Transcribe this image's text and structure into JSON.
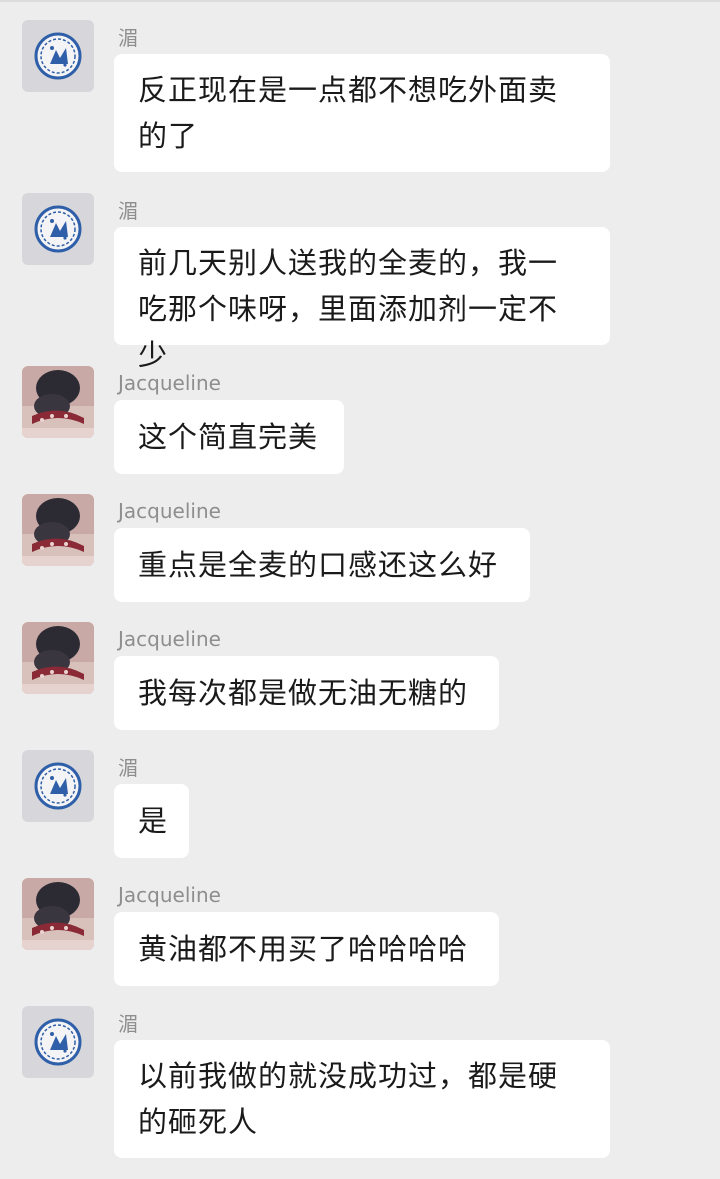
{
  "messages": [
    {
      "sender": "湄",
      "avatar": "blue-circle-logo-avatar",
      "text": "反正现在是一点都不想吃外面卖的了"
    },
    {
      "sender": "湄",
      "avatar": "blue-circle-logo-avatar",
      "text": "前几天别人送我的全麦的，我一吃那个味呀，里面添加剂一定不少"
    },
    {
      "sender": "Jacqueline",
      "avatar": "photo-avatar",
      "text": "这个简直完美"
    },
    {
      "sender": "Jacqueline",
      "avatar": "photo-avatar",
      "text": "重点是全麦的口感还这么好"
    },
    {
      "sender": "Jacqueline",
      "avatar": "photo-avatar",
      "text": "我每次都是做无油无糖的"
    },
    {
      "sender": "湄",
      "avatar": "blue-circle-logo-avatar",
      "text": "是"
    },
    {
      "sender": "Jacqueline",
      "avatar": "photo-avatar",
      "text": "黄油都不用买了哈哈哈哈"
    },
    {
      "sender": "湄",
      "avatar": "blue-circle-logo-avatar",
      "text": "以前我做的就没成功过，都是硬的砸死人"
    }
  ],
  "colors": {
    "background": "#ededed",
    "bubble": "#ffffff",
    "sender_name": "#8e8e8e",
    "text": "#1a1a1a",
    "logo_blue": "#2f5fa8"
  }
}
